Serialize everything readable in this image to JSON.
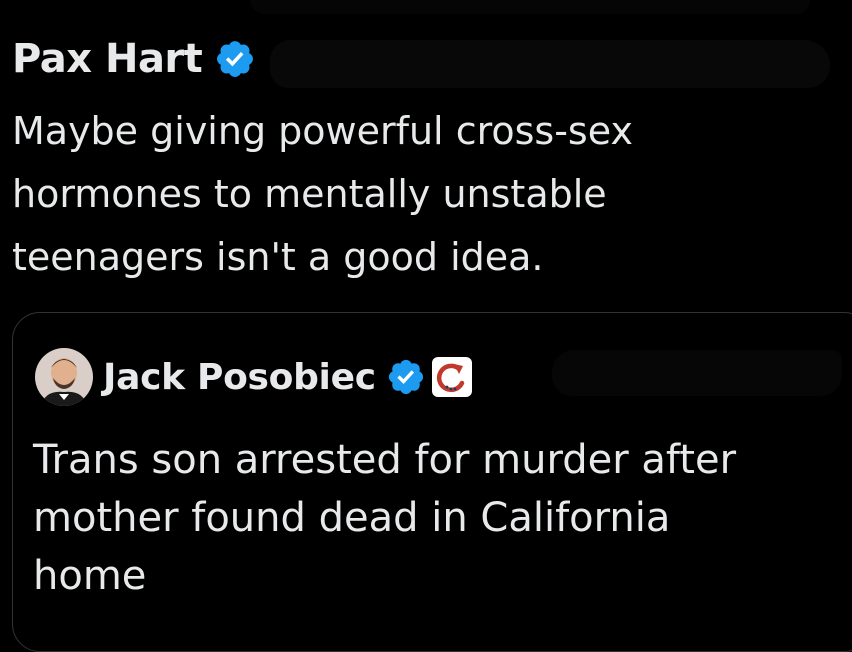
{
  "tweet": {
    "author_name": "Pax Hart",
    "verified_icon": "verified-badge-icon",
    "text_lines": [
      "Maybe giving powerful cross-sex",
      "hormones to mentally unstable",
      "teenagers isn't a good idea."
    ]
  },
  "quoted_tweet": {
    "author_name": "Jack Posobiec",
    "verified_icon": "verified-badge-icon",
    "affiliate_icon": "affiliate-logo-icon",
    "avatar_icon": "avatar",
    "text_lines": [
      "Trans son arrested for murder after",
      "mother found dead in California",
      "home"
    ]
  },
  "colors": {
    "background": "#000000",
    "text": "#e7e9ea",
    "verified_blue": "#1d9bf0",
    "card_border": "#2f3336"
  }
}
